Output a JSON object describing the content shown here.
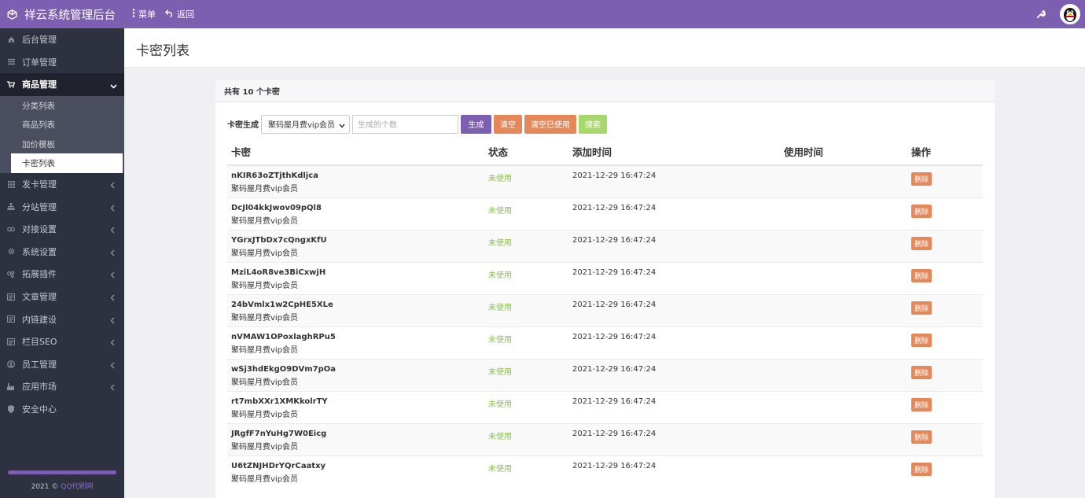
{
  "app": {
    "title": "祥云系统管理后台",
    "menu_label": "菜单",
    "back_label": "返回"
  },
  "sidebar": {
    "items": [
      {
        "label": "后台管理",
        "icon": "home-icon",
        "arrow": false
      },
      {
        "label": "订单管理",
        "icon": "list-icon",
        "arrow": false
      },
      {
        "label": "商品管理",
        "icon": "cart-icon",
        "arrow": "down"
      },
      {
        "label": "发卡管理",
        "icon": "grid-icon",
        "arrow": "left"
      },
      {
        "label": "分站管理",
        "icon": "sitemap-icon",
        "arrow": "left"
      },
      {
        "label": "对接设置",
        "icon": "link-icon",
        "arrow": "left"
      },
      {
        "label": "系统设置",
        "icon": "gear-icon",
        "arrow": "left"
      },
      {
        "label": "拓展插件",
        "icon": "plugin-icon",
        "arrow": "left"
      },
      {
        "label": "文章管理",
        "icon": "article-icon",
        "arrow": "left"
      },
      {
        "label": "内链建设",
        "icon": "chain-icon",
        "arrow": "left"
      },
      {
        "label": "栏目SEO",
        "icon": "seo-icon",
        "arrow": "left"
      },
      {
        "label": "员工管理",
        "icon": "user-icon",
        "arrow": "left"
      },
      {
        "label": "应用市场",
        "icon": "store-icon",
        "arrow": "left"
      },
      {
        "label": "安全中心",
        "icon": "shield-icon",
        "arrow": false
      }
    ],
    "sub_items": [
      "分类列表",
      "商品列表",
      "加价模板",
      "卡密列表"
    ],
    "footer_year": "2021 ©",
    "footer_link": "QQ代刷网"
  },
  "page": {
    "title": "卡密列表",
    "count_text": "共有 10 个卡密"
  },
  "toolbar": {
    "label": "卡密生成",
    "select_value": "聚码屋月费vip会员",
    "input_placeholder": "生成的个数",
    "generate_label": "生成",
    "clear_label": "清空",
    "clear_used_label": "清空已使用",
    "search_label": "搜索"
  },
  "table": {
    "headers": [
      "卡密",
      "状态",
      "添加时间",
      "使用时间",
      "操作"
    ],
    "delete_label": "删除",
    "rows": [
      {
        "code": "nKIR63oZTjthKdljca",
        "goods": "聚码屋月费vip会员",
        "status": "未使用",
        "added": "2021-12-29 16:47:24",
        "used": ""
      },
      {
        "code": "DcJl04kkJwov09pQl8",
        "goods": "聚码屋月费vip会员",
        "status": "未使用",
        "added": "2021-12-29 16:47:24",
        "used": ""
      },
      {
        "code": "YGrxJTbDx7cQngxKfU",
        "goods": "聚码屋月费vip会员",
        "status": "未使用",
        "added": "2021-12-29 16:47:24",
        "used": ""
      },
      {
        "code": "MziL4oR8ve3BiCxwjH",
        "goods": "聚码屋月费vip会员",
        "status": "未使用",
        "added": "2021-12-29 16:47:24",
        "used": ""
      },
      {
        "code": "24bVmlx1w2CpHE5XLe",
        "goods": "聚码屋月费vip会员",
        "status": "未使用",
        "added": "2021-12-29 16:47:24",
        "used": ""
      },
      {
        "code": "nVMAW1OPoxlaghRPu5",
        "goods": "聚码屋月费vip会员",
        "status": "未使用",
        "added": "2021-12-29 16:47:24",
        "used": ""
      },
      {
        "code": "wSj3hdEkgO9DVm7pOa",
        "goods": "聚码屋月费vip会员",
        "status": "未使用",
        "added": "2021-12-29 16:47:24",
        "used": ""
      },
      {
        "code": "rt7mbXXr1XMKkolrTY",
        "goods": "聚码屋月费vip会员",
        "status": "未使用",
        "added": "2021-12-29 16:47:24",
        "used": ""
      },
      {
        "code": "JRgfF7nYuHg7W0Eicg",
        "goods": "聚码屋月费vip会员",
        "status": "未使用",
        "added": "2021-12-29 16:47:24",
        "used": ""
      },
      {
        "code": "U6tZNJHDrYQrCaatxy",
        "goods": "聚码屋月费vip会员",
        "status": "未使用",
        "added": "2021-12-29 16:47:24",
        "used": ""
      }
    ]
  },
  "colors": {
    "accent": "#7d5fb2",
    "sidebar_bg": "#2e3140",
    "status_unused": "#8cc152",
    "button_orange": "#e4885a",
    "button_green": "#a8d86b"
  }
}
